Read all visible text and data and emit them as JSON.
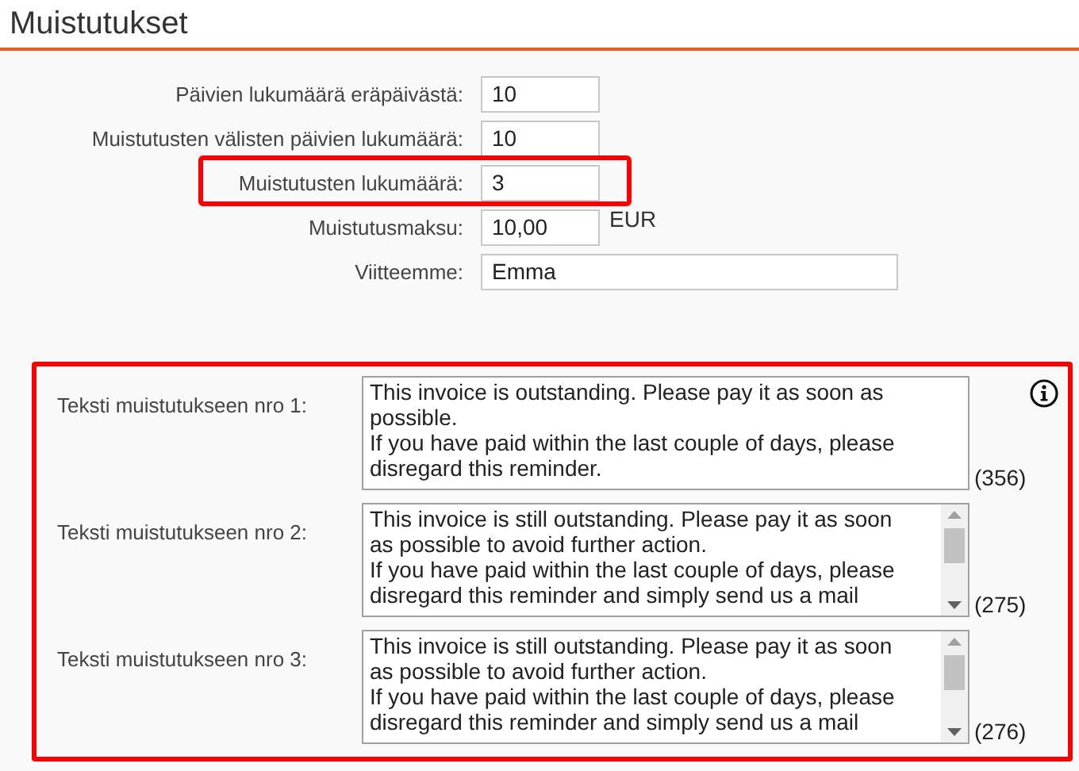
{
  "title": "Muistutukset",
  "fields": [
    {
      "label": "Päivien lukumäärä eräpäivästä:",
      "value": "10",
      "wide": false,
      "highlighted": false
    },
    {
      "label": "Muistutusten välisten päivien lukumäärä:",
      "value": "10",
      "wide": false,
      "highlighted": false
    },
    {
      "label": "Muistutusten lukumäärä:",
      "value": "3",
      "wide": false,
      "highlighted": true
    },
    {
      "label": "Muistutusmaksu:",
      "value": "10,00",
      "unit": "EUR",
      "wide": false,
      "highlighted": false
    },
    {
      "label": "Viitteemme:",
      "value": "Emma",
      "wide": true,
      "highlighted": false
    }
  ],
  "texts_highlighted": true,
  "texts": [
    {
      "label": "Teksti muistutukseen nro 1:",
      "lines": [
        "This invoice is outstanding. Please pay it as soon as",
        "possible.",
        "If you have paid within the last couple of days, please",
        "disregard this reminder."
      ],
      "scrollable": false,
      "count": "(356)"
    },
    {
      "label": "Teksti muistutukseen nro 2:",
      "lines": [
        "This invoice is still outstanding. Please pay it as soon",
        "as possible to avoid further action.",
        "If you have paid within the last couple of days, please",
        "disregard this reminder and simply send us a mail"
      ],
      "scrollable": true,
      "count": "(275)"
    },
    {
      "label": "Teksti muistutukseen nro 3:",
      "lines": [
        "This invoice is still outstanding. Please pay it as soon",
        "as possible to avoid further action.",
        "If you have paid within the last couple of days, please",
        "disregard this reminder and simply send us a mail"
      ],
      "scrollable": true,
      "count": "(276)"
    }
  ]
}
